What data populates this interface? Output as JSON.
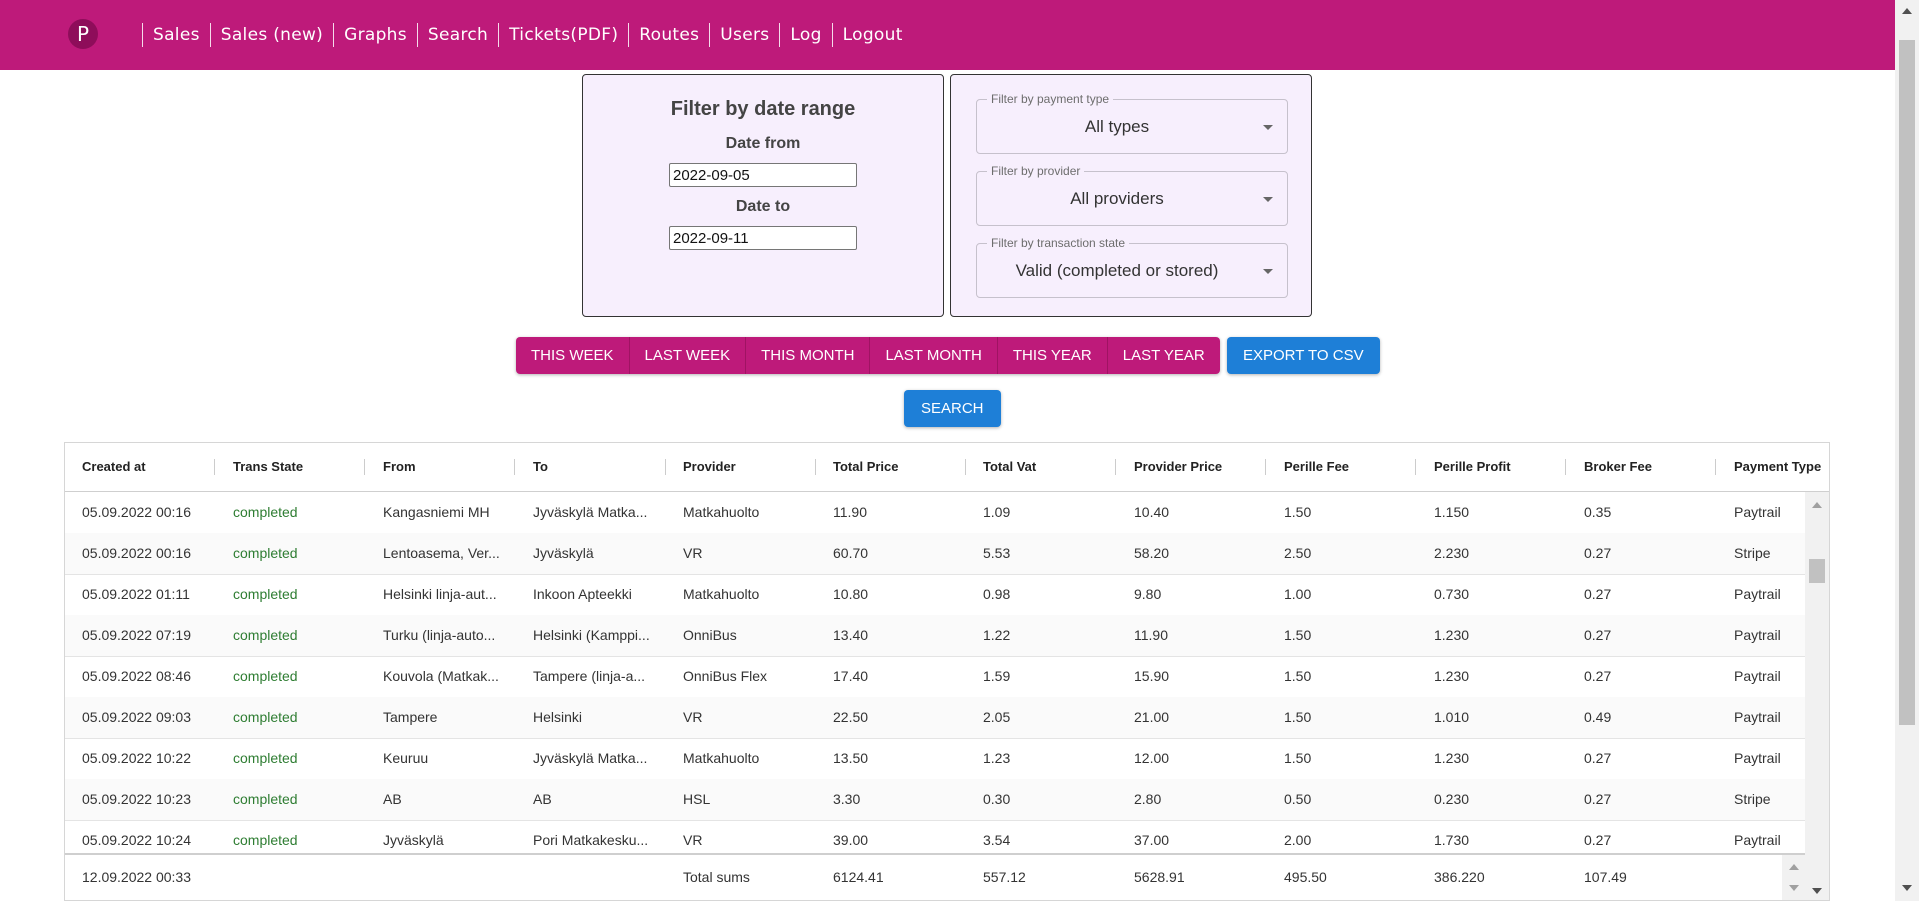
{
  "nav": {
    "logo_letter": "P",
    "items": [
      "Sales",
      "Sales (new)",
      "Graphs",
      "Search",
      "Tickets(PDF)",
      "Routes",
      "Users",
      "Log",
      "Logout"
    ]
  },
  "date_filter": {
    "title": "Filter by date range",
    "from_label": "Date from",
    "from_value": "2022-09-05",
    "to_label": "Date to",
    "to_value": "2022-09-11"
  },
  "filters": {
    "payment_type": {
      "legend": "Filter by payment type",
      "value": "All types"
    },
    "provider": {
      "legend": "Filter by provider",
      "value": "All providers"
    },
    "transaction_state": {
      "legend": "Filter by transaction state",
      "value": "Valid (completed or stored)"
    }
  },
  "range_buttons": [
    "THIS WEEK",
    "LAST WEEK",
    "THIS MONTH",
    "LAST MONTH",
    "THIS YEAR",
    "LAST YEAR"
  ],
  "export_label": "EXPORT TO CSV",
  "search_label": "SEARCH",
  "table": {
    "headers": [
      "Created at",
      "Trans State",
      "From",
      "To",
      "Provider",
      "Total Price",
      "Total Vat",
      "Provider Price",
      "Perille Fee",
      "Perille Profit",
      "Broker Fee",
      "Payment Type"
    ],
    "rows": [
      [
        "05.09.2022 00:16",
        "completed",
        "Kangasniemi MH",
        "Jyväskylä Matka...",
        "Matkahuolto",
        "11.90",
        "1.09",
        "10.40",
        "1.50",
        "1.150",
        "0.35",
        "Paytrail"
      ],
      [
        "05.09.2022 00:16",
        "completed",
        "Lentoasema, Ver...",
        "Jyväskylä",
        "VR",
        "60.70",
        "5.53",
        "58.20",
        "2.50",
        "2.230",
        "0.27",
        "Stripe"
      ],
      [
        "05.09.2022 01:11",
        "completed",
        "Helsinki linja-aut...",
        "Inkoon Apteekki",
        "Matkahuolto",
        "10.80",
        "0.98",
        "9.80",
        "1.00",
        "0.730",
        "0.27",
        "Paytrail"
      ],
      [
        "05.09.2022 07:19",
        "completed",
        "Turku (linja-auto...",
        "Helsinki (Kamppi...",
        "OnniBus",
        "13.40",
        "1.22",
        "11.90",
        "1.50",
        "1.230",
        "0.27",
        "Paytrail"
      ],
      [
        "05.09.2022 08:46",
        "completed",
        "Kouvola (Matkak...",
        "Tampere (linja-a...",
        "OnniBus Flex",
        "17.40",
        "1.59",
        "15.90",
        "1.50",
        "1.230",
        "0.27",
        "Paytrail"
      ],
      [
        "05.09.2022 09:03",
        "completed",
        "Tampere",
        "Helsinki",
        "VR",
        "22.50",
        "2.05",
        "21.00",
        "1.50",
        "1.010",
        "0.49",
        "Paytrail"
      ],
      [
        "05.09.2022 10:22",
        "completed",
        "Keuruu",
        "Jyväskylä Matka...",
        "Matkahuolto",
        "13.50",
        "1.23",
        "12.00",
        "1.50",
        "1.230",
        "0.27",
        "Paytrail"
      ],
      [
        "05.09.2022 10:23",
        "completed",
        "AB",
        "AB",
        "HSL",
        "3.30",
        "0.30",
        "2.80",
        "0.50",
        "0.230",
        "0.27",
        "Stripe"
      ],
      [
        "05.09.2022 10:24",
        "completed",
        "Jyväskylä",
        "Pori Matkakesku...",
        "VR",
        "39.00",
        "3.54",
        "37.00",
        "2.00",
        "1.730",
        "0.27",
        "Paytrail"
      ]
    ],
    "sums": [
      "12.09.2022 00:33",
      "",
      "",
      "",
      "Total sums",
      "6124.41",
      "557.12",
      "5628.91",
      "495.50",
      "386.220",
      "107.49",
      ""
    ]
  }
}
